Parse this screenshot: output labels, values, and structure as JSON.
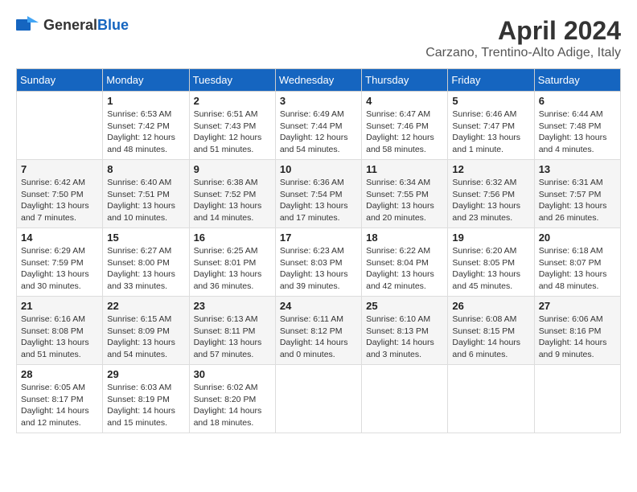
{
  "header": {
    "logo_general": "General",
    "logo_blue": "Blue",
    "month_title": "April 2024",
    "location": "Carzano, Trentino-Alto Adige, Italy"
  },
  "days_of_week": [
    "Sunday",
    "Monday",
    "Tuesday",
    "Wednesday",
    "Thursday",
    "Friday",
    "Saturday"
  ],
  "weeks": [
    [
      {
        "day": "",
        "info": ""
      },
      {
        "day": "1",
        "info": "Sunrise: 6:53 AM\nSunset: 7:42 PM\nDaylight: 12 hours\nand 48 minutes."
      },
      {
        "day": "2",
        "info": "Sunrise: 6:51 AM\nSunset: 7:43 PM\nDaylight: 12 hours\nand 51 minutes."
      },
      {
        "day": "3",
        "info": "Sunrise: 6:49 AM\nSunset: 7:44 PM\nDaylight: 12 hours\nand 54 minutes."
      },
      {
        "day": "4",
        "info": "Sunrise: 6:47 AM\nSunset: 7:46 PM\nDaylight: 12 hours\nand 58 minutes."
      },
      {
        "day": "5",
        "info": "Sunrise: 6:46 AM\nSunset: 7:47 PM\nDaylight: 13 hours\nand 1 minute."
      },
      {
        "day": "6",
        "info": "Sunrise: 6:44 AM\nSunset: 7:48 PM\nDaylight: 13 hours\nand 4 minutes."
      }
    ],
    [
      {
        "day": "7",
        "info": "Sunrise: 6:42 AM\nSunset: 7:50 PM\nDaylight: 13 hours\nand 7 minutes."
      },
      {
        "day": "8",
        "info": "Sunrise: 6:40 AM\nSunset: 7:51 PM\nDaylight: 13 hours\nand 10 minutes."
      },
      {
        "day": "9",
        "info": "Sunrise: 6:38 AM\nSunset: 7:52 PM\nDaylight: 13 hours\nand 14 minutes."
      },
      {
        "day": "10",
        "info": "Sunrise: 6:36 AM\nSunset: 7:54 PM\nDaylight: 13 hours\nand 17 minutes."
      },
      {
        "day": "11",
        "info": "Sunrise: 6:34 AM\nSunset: 7:55 PM\nDaylight: 13 hours\nand 20 minutes."
      },
      {
        "day": "12",
        "info": "Sunrise: 6:32 AM\nSunset: 7:56 PM\nDaylight: 13 hours\nand 23 minutes."
      },
      {
        "day": "13",
        "info": "Sunrise: 6:31 AM\nSunset: 7:57 PM\nDaylight: 13 hours\nand 26 minutes."
      }
    ],
    [
      {
        "day": "14",
        "info": "Sunrise: 6:29 AM\nSunset: 7:59 PM\nDaylight: 13 hours\nand 30 minutes."
      },
      {
        "day": "15",
        "info": "Sunrise: 6:27 AM\nSunset: 8:00 PM\nDaylight: 13 hours\nand 33 minutes."
      },
      {
        "day": "16",
        "info": "Sunrise: 6:25 AM\nSunset: 8:01 PM\nDaylight: 13 hours\nand 36 minutes."
      },
      {
        "day": "17",
        "info": "Sunrise: 6:23 AM\nSunset: 8:03 PM\nDaylight: 13 hours\nand 39 minutes."
      },
      {
        "day": "18",
        "info": "Sunrise: 6:22 AM\nSunset: 8:04 PM\nDaylight: 13 hours\nand 42 minutes."
      },
      {
        "day": "19",
        "info": "Sunrise: 6:20 AM\nSunset: 8:05 PM\nDaylight: 13 hours\nand 45 minutes."
      },
      {
        "day": "20",
        "info": "Sunrise: 6:18 AM\nSunset: 8:07 PM\nDaylight: 13 hours\nand 48 minutes."
      }
    ],
    [
      {
        "day": "21",
        "info": "Sunrise: 6:16 AM\nSunset: 8:08 PM\nDaylight: 13 hours\nand 51 minutes."
      },
      {
        "day": "22",
        "info": "Sunrise: 6:15 AM\nSunset: 8:09 PM\nDaylight: 13 hours\nand 54 minutes."
      },
      {
        "day": "23",
        "info": "Sunrise: 6:13 AM\nSunset: 8:11 PM\nDaylight: 13 hours\nand 57 minutes."
      },
      {
        "day": "24",
        "info": "Sunrise: 6:11 AM\nSunset: 8:12 PM\nDaylight: 14 hours\nand 0 minutes."
      },
      {
        "day": "25",
        "info": "Sunrise: 6:10 AM\nSunset: 8:13 PM\nDaylight: 14 hours\nand 3 minutes."
      },
      {
        "day": "26",
        "info": "Sunrise: 6:08 AM\nSunset: 8:15 PM\nDaylight: 14 hours\nand 6 minutes."
      },
      {
        "day": "27",
        "info": "Sunrise: 6:06 AM\nSunset: 8:16 PM\nDaylight: 14 hours\nand 9 minutes."
      }
    ],
    [
      {
        "day": "28",
        "info": "Sunrise: 6:05 AM\nSunset: 8:17 PM\nDaylight: 14 hours\nand 12 minutes."
      },
      {
        "day": "29",
        "info": "Sunrise: 6:03 AM\nSunset: 8:19 PM\nDaylight: 14 hours\nand 15 minutes."
      },
      {
        "day": "30",
        "info": "Sunrise: 6:02 AM\nSunset: 8:20 PM\nDaylight: 14 hours\nand 18 minutes."
      },
      {
        "day": "",
        "info": ""
      },
      {
        "day": "",
        "info": ""
      },
      {
        "day": "",
        "info": ""
      },
      {
        "day": "",
        "info": ""
      }
    ]
  ]
}
